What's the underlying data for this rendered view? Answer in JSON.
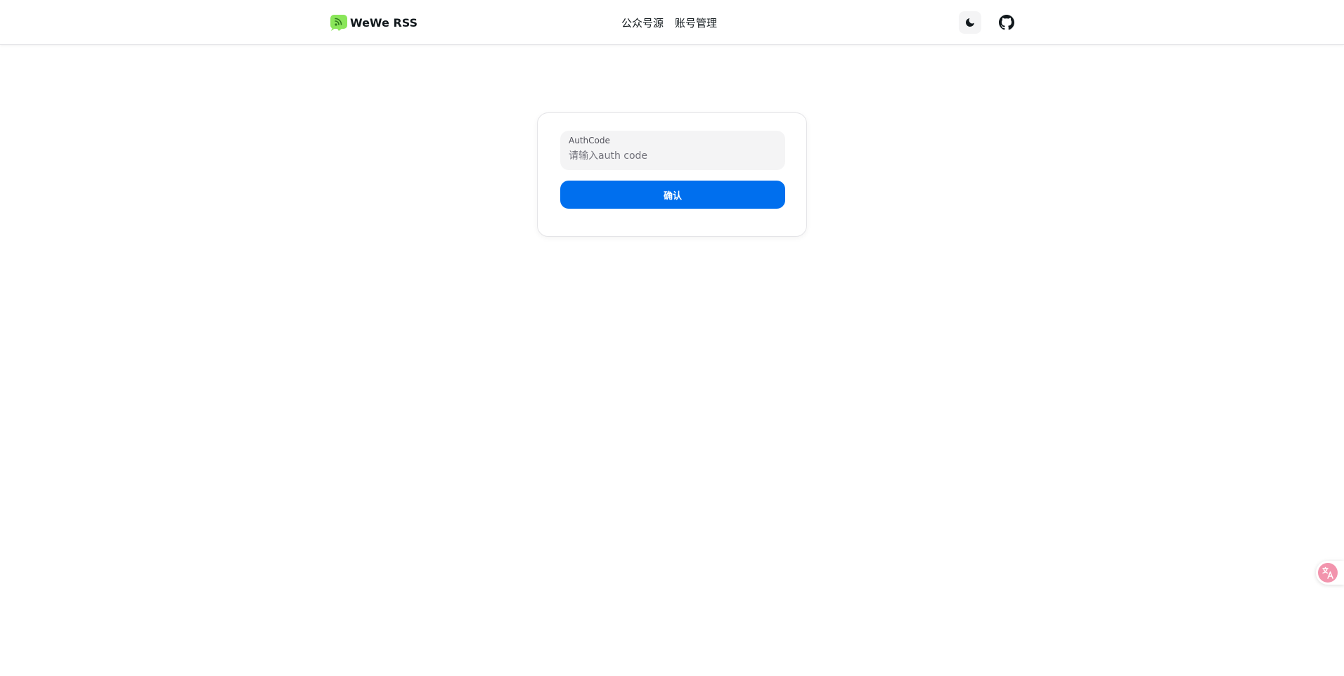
{
  "navbar": {
    "brand_title": "WeWe RSS",
    "brand_logo_icon": "rss-chat-bubble-icon",
    "nav_items": [
      {
        "label": "公众号源"
      },
      {
        "label": "账号管理"
      }
    ],
    "theme_toggle_icon": "moon-icon",
    "github_icon": "github-icon"
  },
  "login_form": {
    "field_label": "AuthCode",
    "field_value": "",
    "field_placeholder": "请输入auth code",
    "submit_label": "确认"
  },
  "floating_widget": {
    "icon": "translate-icon"
  },
  "colors": {
    "primary": "#006fee",
    "logo_green": "#8ae65a",
    "input_bg": "#f4f4f5",
    "translate_pink": "#f294ad"
  }
}
